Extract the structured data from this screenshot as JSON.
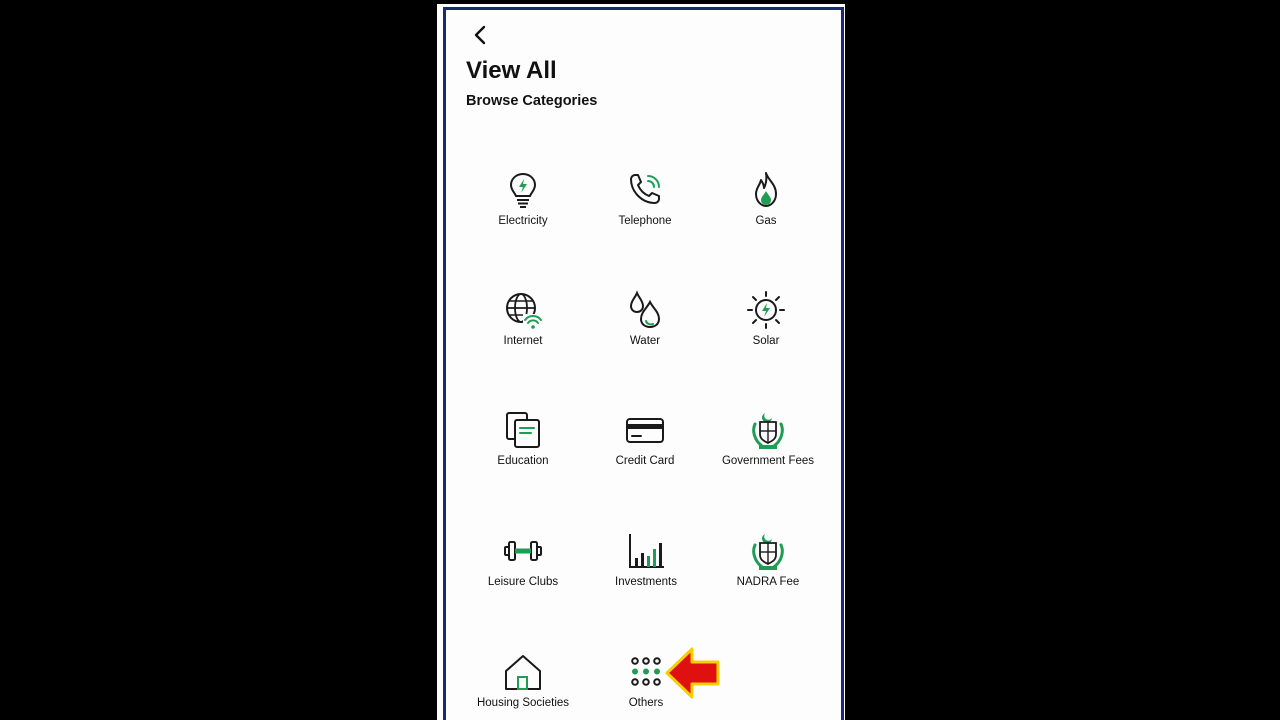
{
  "header": {
    "title": "View All",
    "subtitle": "Browse Categories"
  },
  "icons": {
    "back": "chevron-left-icon",
    "annotation": "red-arrow-pointer"
  },
  "colors": {
    "accent": "#1f9d55",
    "icon_stroke": "#1a1a1a",
    "frame_border": "#1a2a7a",
    "annotation_arrow": "#e01010",
    "annotation_outline": "#f5d000"
  },
  "categories": [
    {
      "label": "Electricity",
      "icon": "lightbulb-icon"
    },
    {
      "label": "Telephone",
      "icon": "phone-icon"
    },
    {
      "label": "Gas",
      "icon": "flame-icon"
    },
    {
      "label": "Internet",
      "icon": "globe-wifi-icon"
    },
    {
      "label": "Water",
      "icon": "water-drops-icon"
    },
    {
      "label": "Solar",
      "icon": "sun-bolt-icon"
    },
    {
      "label": "Education",
      "icon": "documents-icon"
    },
    {
      "label": "Credit Card",
      "icon": "credit-card-icon"
    },
    {
      "label": "Government Fees",
      "icon": "government-emblem-icon"
    },
    {
      "label": "Leisure Clubs",
      "icon": "dumbbell-icon"
    },
    {
      "label": "Investments",
      "icon": "bar-chart-icon"
    },
    {
      "label": "NADRA Fee",
      "icon": "national-emblem-icon"
    },
    {
      "label": "Housing Societies",
      "icon": "house-icon"
    },
    {
      "label": "Others",
      "icon": "grid-dots-icon"
    }
  ]
}
